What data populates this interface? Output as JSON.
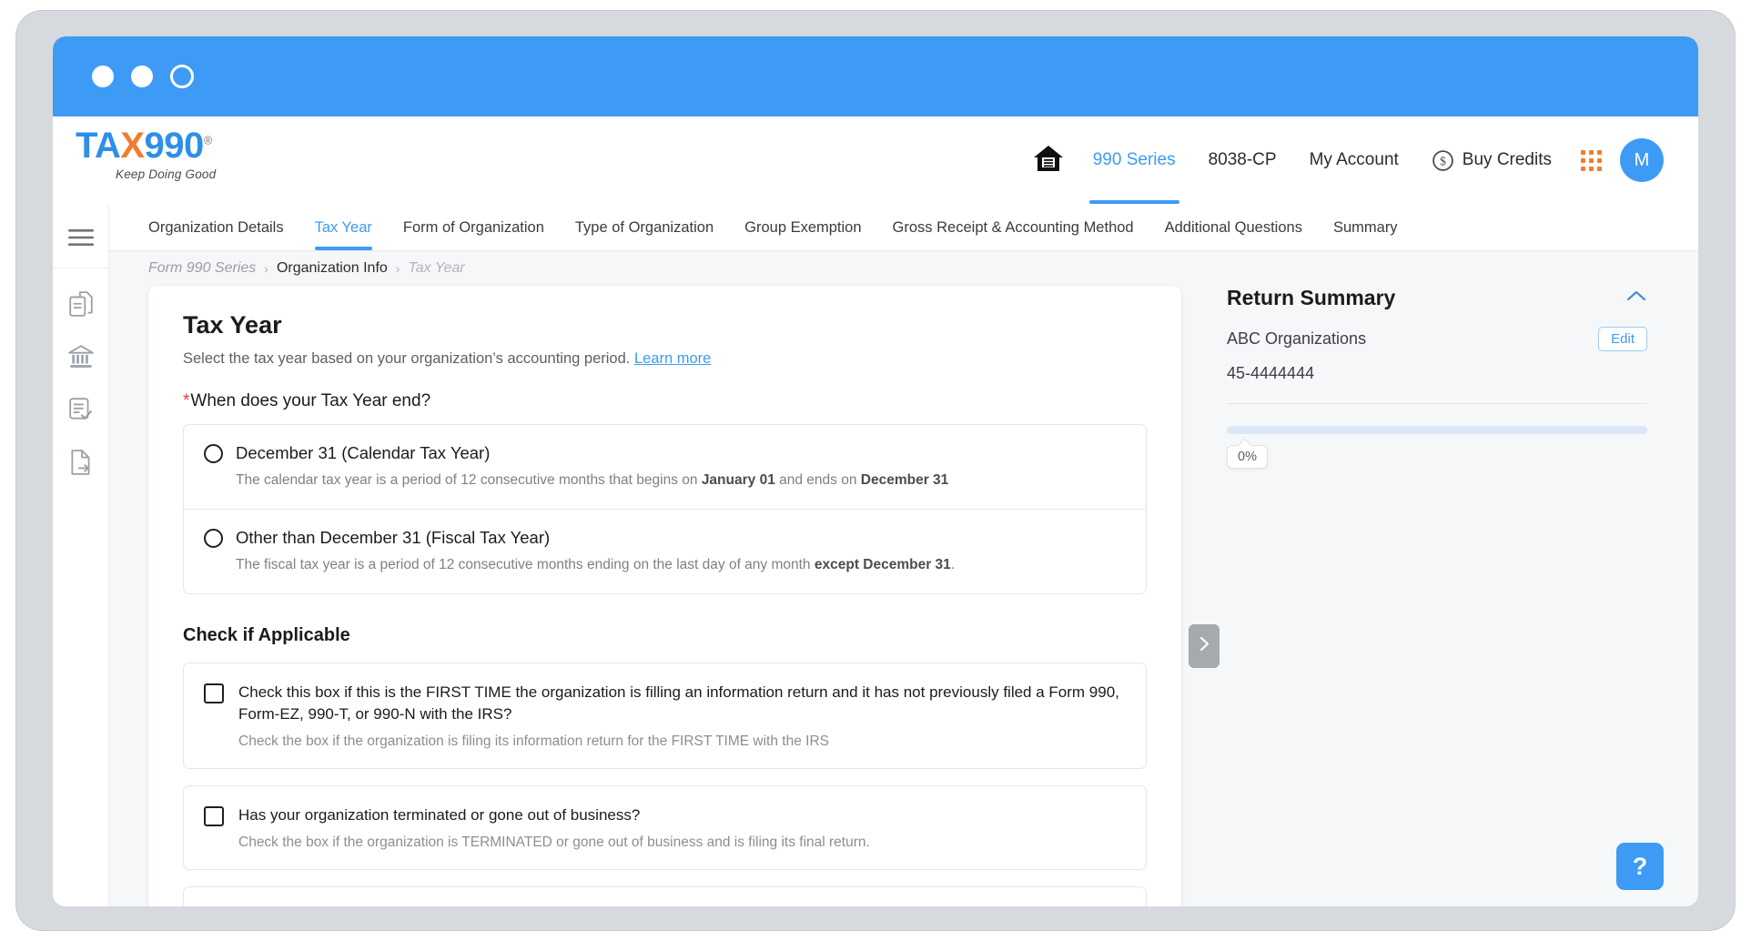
{
  "chrome": {
    "dots": [
      "window-dot-1",
      "window-dot-2",
      "window-dot-3"
    ]
  },
  "brand": {
    "name_part1": "TA",
    "name_x": "X",
    "name_part2": "990",
    "registered": "®",
    "tagline": "Keep Doing Good",
    "blue": "#2f8fe8",
    "orange": "#f07d2e"
  },
  "header": {
    "home_icon": "home-icon",
    "nav": [
      {
        "label": "990 Series",
        "active": true
      },
      {
        "label": "8038-CP",
        "active": false
      },
      {
        "label": "My Account",
        "active": false
      }
    ],
    "buy_credits": "Buy Credits",
    "credits_icon": "dollar-circle-icon",
    "apps_icon": "grid-apps-icon",
    "avatar_initial": "M",
    "accent": "#3d9bf5"
  },
  "rail": {
    "items": [
      "hamburger-menu-icon",
      "documents-copy-icon",
      "bank-institution-icon",
      "form-check-icon",
      "file-export-icon"
    ]
  },
  "tabs": [
    {
      "label": "Organization Details",
      "active": false
    },
    {
      "label": "Tax Year",
      "active": true
    },
    {
      "label": "Form of Organization",
      "active": false
    },
    {
      "label": "Type of Organization",
      "active": false
    },
    {
      "label": "Group Exemption",
      "active": false
    },
    {
      "label": "Gross Receipt & Accounting Method",
      "active": false
    },
    {
      "label": "Additional Questions",
      "active": false
    },
    {
      "label": "Summary",
      "active": false
    }
  ],
  "breadcrumb": {
    "item1": "Form 990 Series",
    "sep1": "›",
    "item2": "Organization Info",
    "sep2": "›",
    "item3": "Tax Year"
  },
  "main": {
    "title": "Tax Year",
    "subtitle": "Select the tax year based on your organization’s accounting period.",
    "learn_more": "Learn more",
    "question_label": "When does your Tax Year end?",
    "required_mark": "*",
    "options": [
      {
        "title": "December 31 (Calendar Tax Year)",
        "desc_pre": "The calendar tax year is a period of 12 consecutive months that begins on ",
        "desc_b1": "January 01",
        "desc_mid": " and ends on ",
        "desc_b2": "December 31",
        "desc_post": "",
        "selected": false
      },
      {
        "title": "Other than December 31 (Fiscal Tax Year)",
        "desc_pre": "The fiscal tax year is a period of 12 consecutive months ending on the last day of any month ",
        "desc_b1": "except December 31",
        "desc_mid": "",
        "desc_b2": "",
        "desc_post": ".",
        "selected": false
      }
    ],
    "applicable_title": "Check if Applicable",
    "checkboxes": [
      {
        "label": "Check this box if this is the FIRST TIME the organization is filling an information return and it has not previously filed a Form 990, Form-EZ, 990-T, or 990-N with the IRS?",
        "desc": "Check the box if the organization is filing its information return for the FIRST TIME with the IRS",
        "checked": false
      },
      {
        "label": "Has your organization terminated or gone out of business?",
        "desc": "Check the box if the organization is TERMINATED or gone out of business and is filing its final return.",
        "checked": false
      }
    ]
  },
  "collapse": {
    "icon": "chevron-right-icon"
  },
  "summary": {
    "title": "Return Summary",
    "collapse_icon": "chevron-up-icon",
    "org_name": "ABC Organizations",
    "edit_label": "Edit",
    "ein": "45-4444444",
    "progress_percent": "0%",
    "progress_value": 0
  },
  "help": {
    "label": "?"
  }
}
